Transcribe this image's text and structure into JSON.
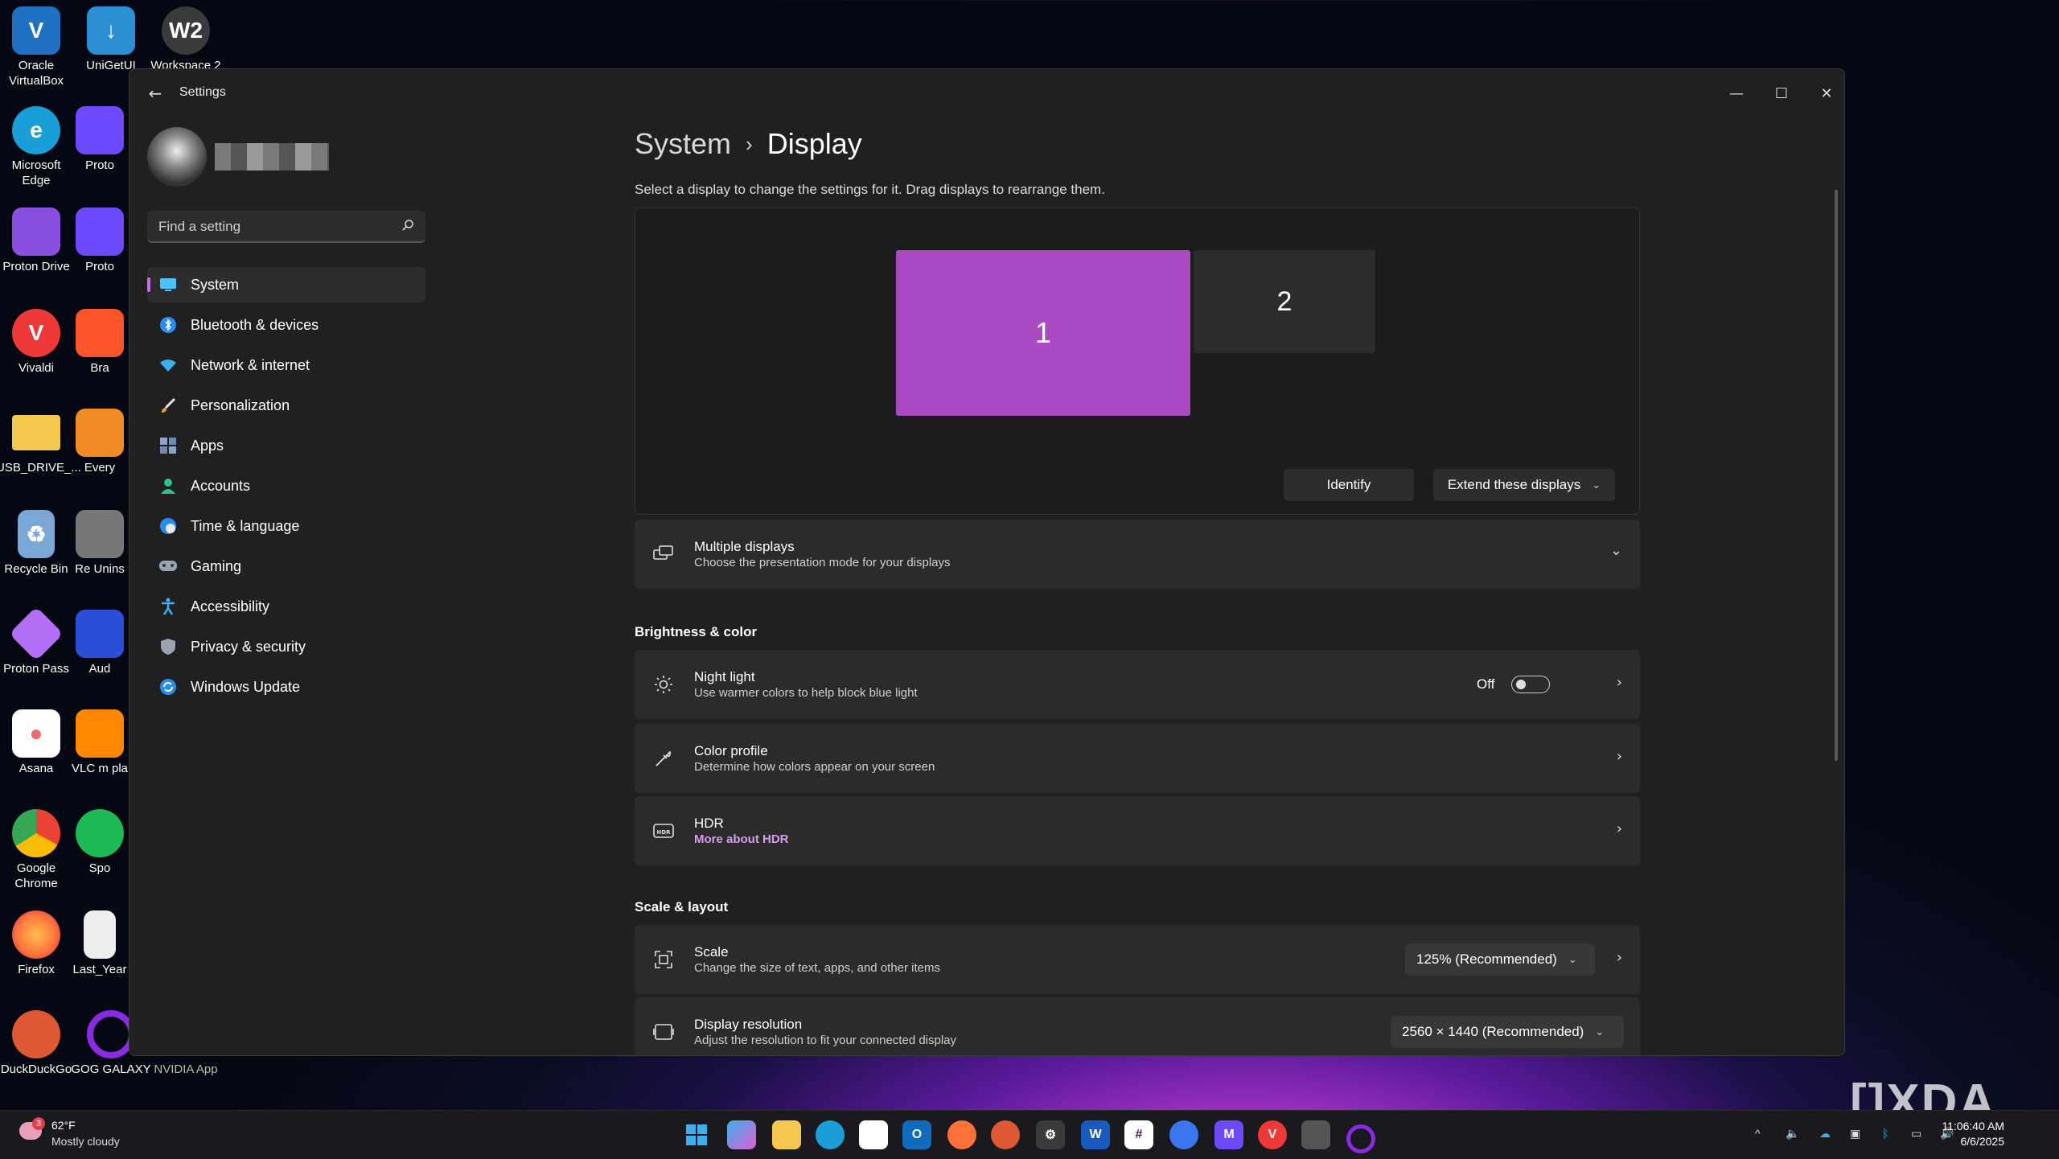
{
  "desktop": {
    "icons": [
      {
        "label": "Oracle VirtualBox",
        "icon": "virtualbox-icon",
        "color": "#1f6fc2"
      },
      {
        "label": "UniGetUI",
        "icon": "unigetui-icon",
        "color": "#2b8fd6"
      },
      {
        "label": "Workspace 2",
        "icon": "workspace-icon",
        "color": "#3a3a3a",
        "glyph": "W2"
      },
      {
        "label": "Microsoft Edge",
        "icon": "edge-icon",
        "color": "#1a9ed8"
      },
      {
        "label": "Proton Drive",
        "icon": "proton-drive-icon",
        "color": "#8a4fe0"
      },
      {
        "label": "Vivaldi",
        "icon": "vivaldi-icon",
        "color": "#ef3939"
      },
      {
        "label": "USB_DRIVE_...",
        "icon": "folder-icon",
        "color": "#f2c94c"
      },
      {
        "label": "Recycle Bin",
        "icon": "recycle-bin-icon",
        "color": "#7aa7d6"
      },
      {
        "label": "Proton Pass",
        "icon": "proton-pass-icon",
        "color": "#b46ef5"
      },
      {
        "label": "Asana",
        "icon": "asana-icon",
        "color": "#f06a6a"
      },
      {
        "label": "Google Chrome",
        "icon": "chrome-icon",
        "color": "#34a853"
      },
      {
        "label": "Firefox",
        "icon": "firefox-icon",
        "color": "#ff7139"
      },
      {
        "label": "DuckDuckGo",
        "icon": "duckduckgo-icon",
        "color": "#de5833"
      },
      {
        "label": "GOG GALAXY",
        "icon": "gog-galaxy-icon",
        "color": "#8a2be2"
      },
      {
        "label": "NVIDIA App",
        "icon": "nvidia-icon",
        "color": "#2a2a2a"
      }
    ],
    "partial_labels": [
      "Proto",
      "Proto",
      "Bra",
      "Every",
      "Re Unins",
      "Aud",
      "VLC m pla",
      "Spo",
      "Last_Year"
    ]
  },
  "window": {
    "title": "Settings",
    "minimize": "—",
    "maximize": "☐",
    "close": "✕"
  },
  "sidebar": {
    "search_placeholder": "Find a setting",
    "items": [
      {
        "label": "System",
        "icon": "system-icon",
        "active": true
      },
      {
        "label": "Bluetooth & devices",
        "icon": "bluetooth-icon"
      },
      {
        "label": "Network & internet",
        "icon": "wifi-icon"
      },
      {
        "label": "Personalization",
        "icon": "brush-icon"
      },
      {
        "label": "Apps",
        "icon": "apps-icon"
      },
      {
        "label": "Accounts",
        "icon": "accounts-icon"
      },
      {
        "label": "Time & language",
        "icon": "globe-clock-icon"
      },
      {
        "label": "Gaming",
        "icon": "controller-icon"
      },
      {
        "label": "Accessibility",
        "icon": "accessibility-icon"
      },
      {
        "label": "Privacy & security",
        "icon": "shield-icon"
      },
      {
        "label": "Windows Update",
        "icon": "update-icon"
      }
    ]
  },
  "content": {
    "breadcrumb_parent": "System",
    "breadcrumb_sep": "›",
    "breadcrumb_current": "Display",
    "description": "Select a display to change the settings for it. Drag displays to rearrange them.",
    "monitors": {
      "one": "1",
      "two": "2"
    },
    "identify_label": "Identify",
    "extend_label": "Extend these displays",
    "multiple_displays": {
      "title": "Multiple displays",
      "subtitle": "Choose the presentation mode for your displays"
    },
    "brightness_header": "Brightness & color",
    "night_light": {
      "title": "Night light",
      "subtitle": "Use warmer colors to help block blue light",
      "state": "Off"
    },
    "color_profile": {
      "title": "Color profile",
      "subtitle": "Determine how colors appear on your screen"
    },
    "hdr": {
      "title": "HDR",
      "link": "More about HDR"
    },
    "scale_header": "Scale & layout",
    "scale": {
      "title": "Scale",
      "subtitle": "Change the size of text, apps, and other items",
      "value": "125% (Recommended)"
    },
    "resolution": {
      "title": "Display resolution",
      "subtitle": "Adjust the resolution to fit your connected display",
      "value": "2560 × 1440 (Recommended)"
    }
  },
  "taskbar": {
    "weather_temp": "62°F",
    "weather_desc": "Mostly cloudy",
    "weather_badge": "3",
    "time": "11:06:40 AM",
    "date": "6/6/2025"
  },
  "watermark": "XDA",
  "colors": {
    "accent": "#a94ac3",
    "link": "#d59cf0"
  }
}
